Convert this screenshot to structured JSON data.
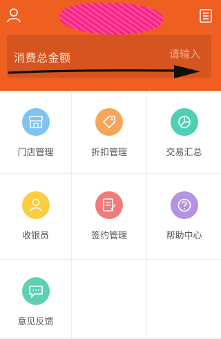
{
  "header": {
    "background": "#ef5f22",
    "amount_label": "消费总金额",
    "amount_placeholder": "请输入",
    "user_icon": "user-icon",
    "menu_icon": "document-list-icon"
  },
  "menu": [
    {
      "label": "门店管理",
      "icon": "store-icon",
      "color": "#7fc4f0"
    },
    {
      "label": "折扣管理",
      "icon": "tag-icon",
      "color": "#f6a65a"
    },
    {
      "label": "交易汇总",
      "icon": "pie-chart-icon",
      "color": "#4fd0b4"
    },
    {
      "label": "收银员",
      "icon": "person-icon",
      "color": "#fccd40"
    },
    {
      "label": "签约管理",
      "icon": "sign-doc-icon",
      "color": "#f17a7a"
    },
    {
      "label": "帮助中心",
      "icon": "help-icon",
      "color": "#b494e0"
    },
    {
      "label": "意见反馈",
      "icon": "chat-bubble-icon",
      "color": "#5fd0b2"
    }
  ]
}
